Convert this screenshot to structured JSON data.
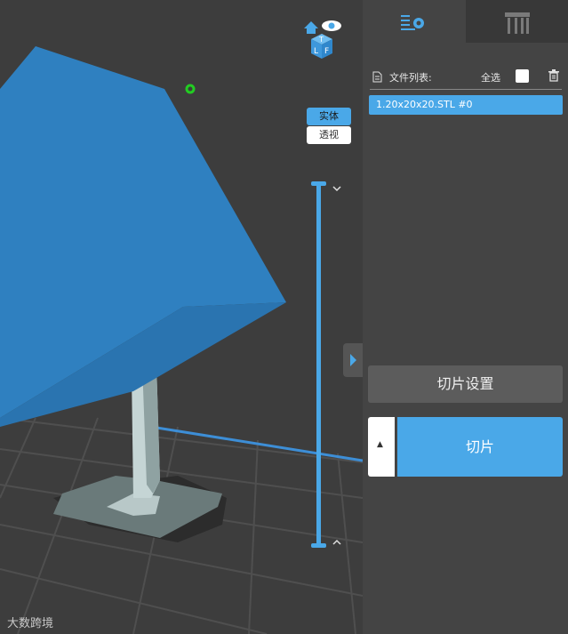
{
  "viewport": {
    "view_modes": {
      "solid": "实体",
      "xray": "透视"
    },
    "layer_slider": {
      "up_icon": "chevron-up-icon",
      "down_icon": "chevron-down-icon"
    },
    "view_cube_faces": {
      "top": "T",
      "left": "L",
      "front": "F"
    },
    "watermark": "大数跨境"
  },
  "panel": {
    "tabs": [
      {
        "name": "settings",
        "icon": "slice-settings-icon",
        "active": true
      },
      {
        "name": "support",
        "icon": "support-structure-icon",
        "active": false
      }
    ],
    "file_list": {
      "label": "文件列表:",
      "select_all": "全选",
      "files": [
        "1.20x20x20.STL #0"
      ]
    },
    "slice_settings_label": "切片设置",
    "slice_label": "切片",
    "expand_icon": "▲"
  },
  "colors": {
    "accent": "#4aa8e8",
    "model_blue": "#2f80c0",
    "support_gray": "#9fb3b3",
    "panel_bg": "#444444",
    "viewport_bg": "#3d3d3d"
  }
}
